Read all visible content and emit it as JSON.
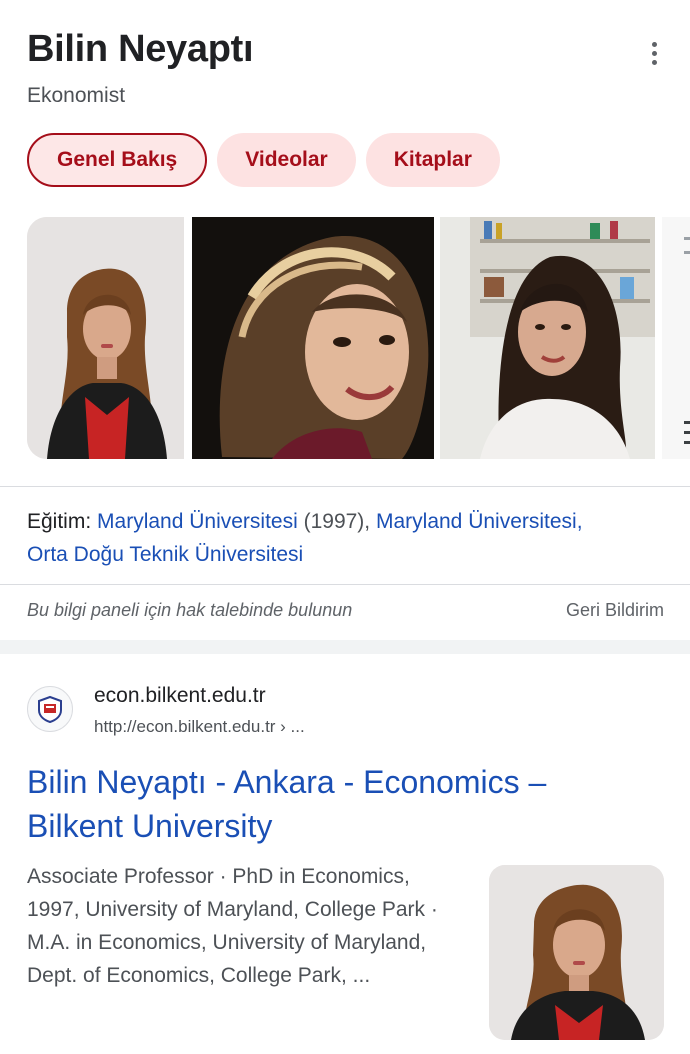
{
  "knowledge_panel": {
    "title": "Bilin Neyaptı",
    "subtitle": "Ekonomist",
    "more_icon": "more-vert-icon",
    "chips": [
      {
        "label": "Genel Bakış",
        "active": true
      },
      {
        "label": "Videolar",
        "active": false
      },
      {
        "label": "Kitaplar",
        "active": false
      }
    ],
    "education": {
      "label": "Eğitim:",
      "items": [
        {
          "text": "Maryland Üniversitesi",
          "link": true
        },
        {
          "text": " (1997), ",
          "link": false
        },
        {
          "text": "Maryland Üniversitesi,",
          "link": true
        },
        {
          "text": "Orta Doğu Teknik Üniversitesi",
          "link": true
        }
      ]
    },
    "claim_text": "Bu bilgi paneli için hak talebinde bulunun",
    "feedback_label": "Geri Bildirim"
  },
  "result": {
    "site_name": "econ.bilkent.edu.tr",
    "url": "http://econ.bilkent.edu.tr › ...",
    "title": "Bilin Neyaptı - Ankara - Economics – Bilkent University",
    "snippet": "Associate Professor · PhD in Economics, 1997, University of Maryland, College Park · M.A. in Economics, University of Maryland, Dept. of Economics, College Park, ..."
  },
  "colors": {
    "chip_bg": "#fde2e2",
    "chip_text": "#a50e1a",
    "link": "#1a4fb5"
  }
}
